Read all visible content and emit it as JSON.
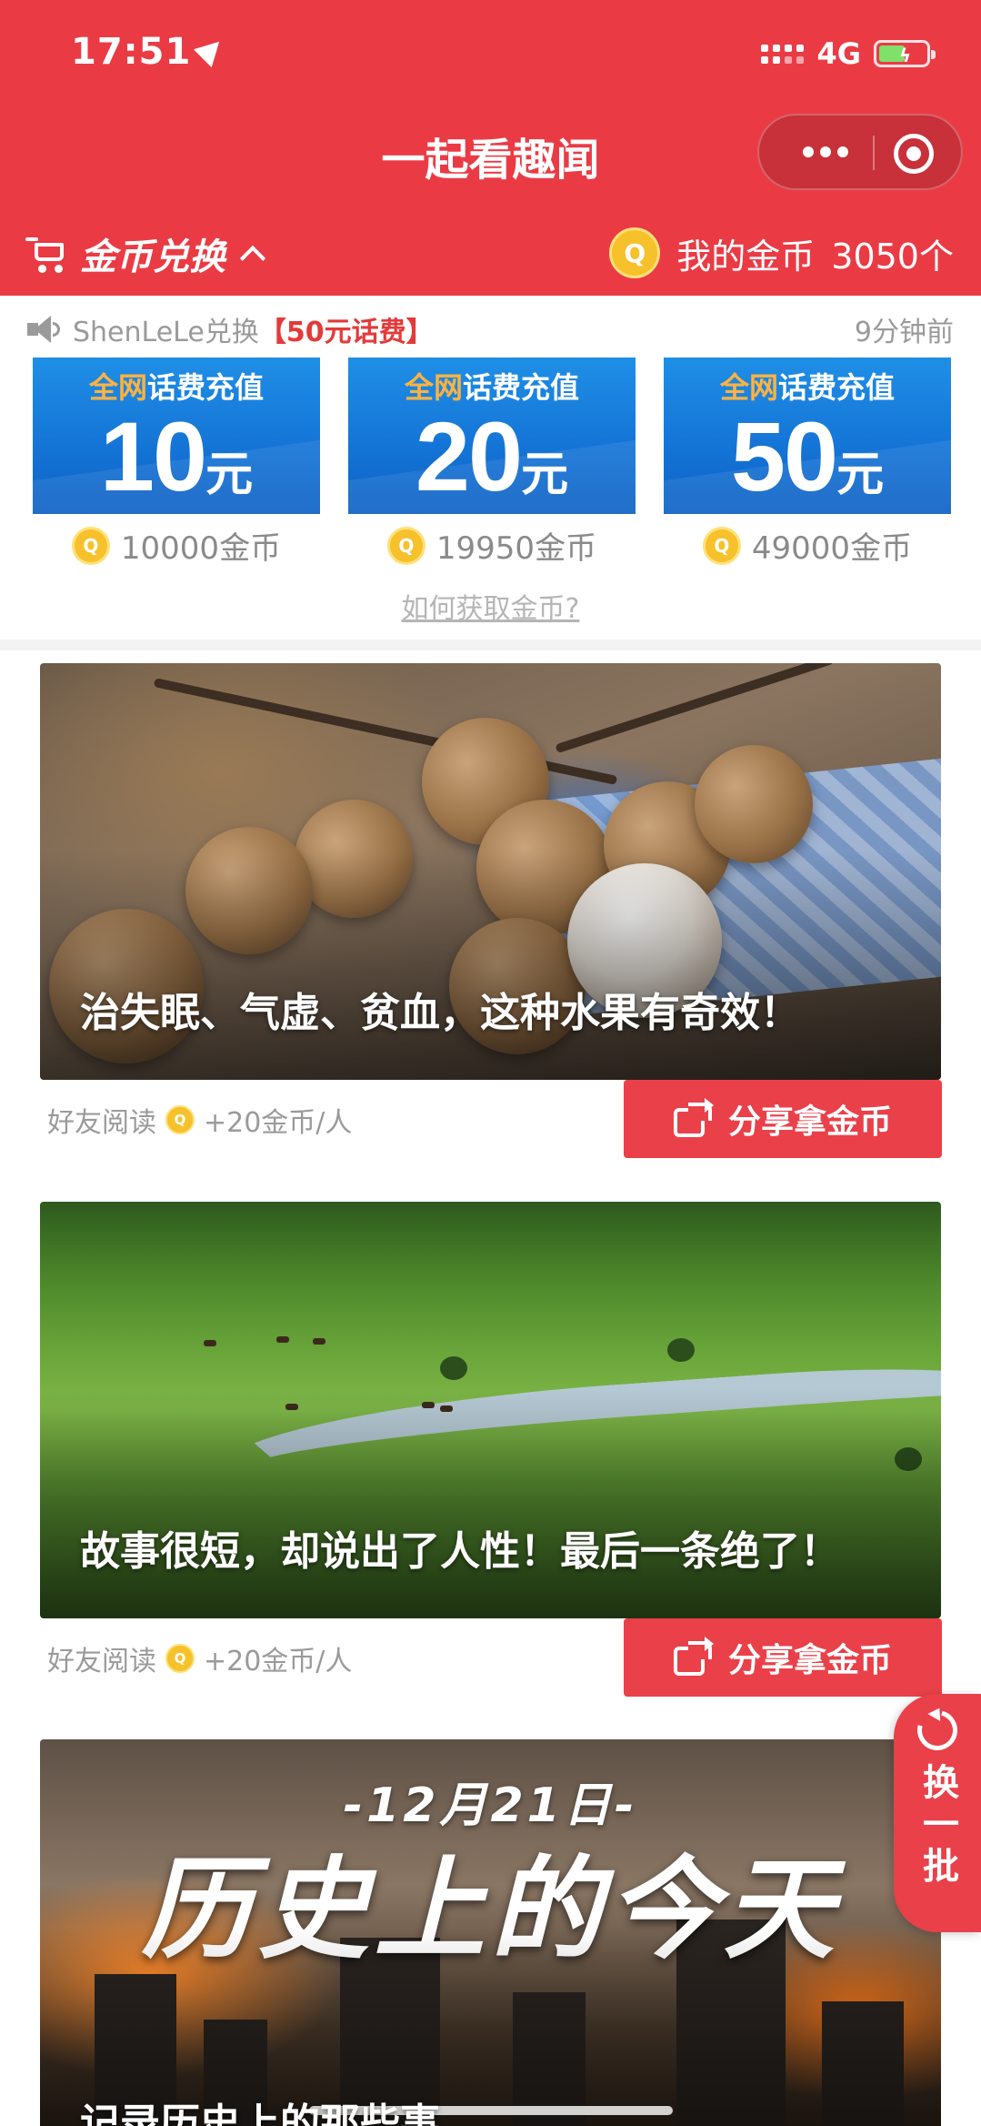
{
  "status_bar": {
    "time": "17:51",
    "network": "4G"
  },
  "header": {
    "title": "一起看趣闻",
    "exchange_label": "金币兑换",
    "my_coins_label": "我的金币",
    "my_coins_value": "3050个",
    "coin_symbol": "Q"
  },
  "ticker": {
    "user": "ShenLeLe兑换",
    "item": "【50元话费】",
    "time_ago": "9分钟前"
  },
  "recharge_cards": [
    {
      "highlight": "全网",
      "subtitle": "话费充值",
      "amount": "10",
      "unit": "元",
      "price": "10000金币"
    },
    {
      "highlight": "全网",
      "subtitle": "话费充值",
      "amount": "20",
      "unit": "元",
      "price": "19950金币"
    },
    {
      "highlight": "全网",
      "subtitle": "话费充值",
      "amount": "50",
      "unit": "元",
      "price": "49000金币"
    }
  ],
  "how_to_link": "如何获取金币?",
  "articles": [
    {
      "caption": "治失眠、气虚、贫血，这种水果有奇效！",
      "reads_label": "好友阅读",
      "reward": "+20金币/人",
      "share_label": "分享拿金币"
    },
    {
      "caption": "故事很短，却说出了人性！最后一条绝了！",
      "reads_label": "好友阅读",
      "reward": "+20金币/人",
      "share_label": "分享拿金币"
    },
    {
      "caption": "记录历史上的那些事",
      "image_date": "-12月21日-",
      "image_title": "历史上的今天"
    }
  ],
  "refresh_button": {
    "label": "换一批"
  },
  "colors": {
    "brand_red": "#ea3b45",
    "coin_gold": "#f6c12a",
    "card_blue": "#1473d6"
  }
}
